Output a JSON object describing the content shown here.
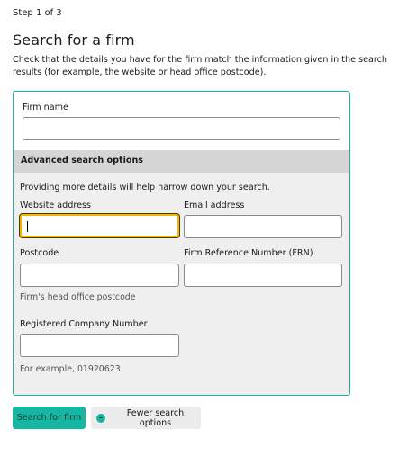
{
  "header": {
    "step": "Step 1 of 3",
    "title": "Search for a firm",
    "intro": "Check that the details you have for the firm match the information given in the search results (for example, the website or head office postcode)."
  },
  "form": {
    "firm_name_label": "Firm name",
    "firm_name_value": "",
    "advanced_title": "Advanced search options",
    "advanced_intro": "Providing more details will help narrow down your search.",
    "website_label": "Website address",
    "website_value": "",
    "email_label": "Email address",
    "email_value": "",
    "postcode_label": "Postcode",
    "postcode_value": "",
    "postcode_hint": "Firm's head office postcode",
    "frn_label": "Firm Reference Number (FRN)",
    "frn_value": "",
    "company_number_label": "Registered Company Number",
    "company_number_value": "",
    "company_number_hint": "For example, 01920623"
  },
  "actions": {
    "search_label": "Search for firm",
    "fewer_options_label": "Fewer search options",
    "fewer_options_icon": "minus-circle-icon"
  },
  "colors": {
    "accent": "#16b7a2",
    "focus": "#f3b700",
    "advanced_header": "#d6d6d6",
    "advanced_body": "#efefef"
  }
}
